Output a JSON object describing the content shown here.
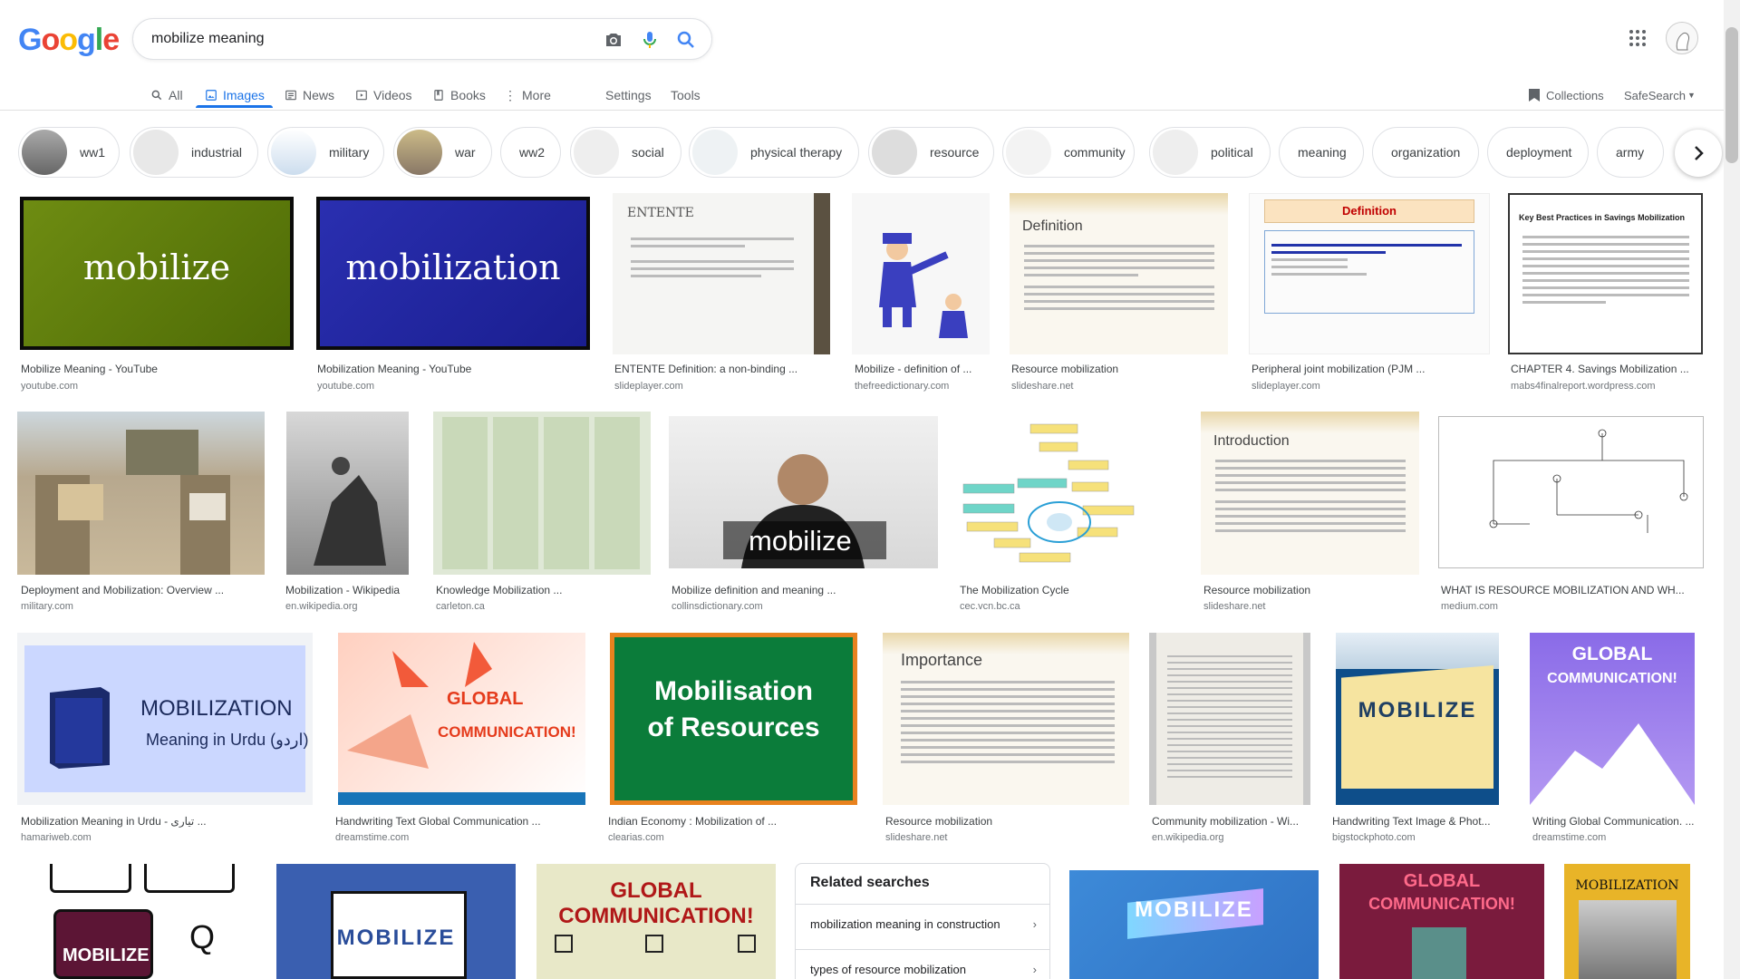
{
  "logo": {
    "letters": [
      "G",
      "o",
      "o",
      "g",
      "l",
      "e"
    ]
  },
  "search": {
    "query": "mobilize meaning"
  },
  "nav": {
    "all": "All",
    "images": "Images",
    "news": "News",
    "videos": "Videos",
    "books": "Books",
    "more": "More",
    "settings": "Settings",
    "tools": "Tools",
    "collections": "Collections",
    "safesearch": "SafeSearch"
  },
  "chips": [
    "ww1",
    "industrial",
    "military",
    "war",
    "ww2",
    "social",
    "physical therapy",
    "resource",
    "community",
    "political",
    "meaning",
    "organization",
    "deployment",
    "army"
  ],
  "results": [
    {
      "caption": "Mobilize Meaning - YouTube",
      "source": "youtube.com",
      "text": "mobilize"
    },
    {
      "caption": "Mobilization Meaning - YouTube",
      "source": "youtube.com",
      "text": "mobilization"
    },
    {
      "caption": "ENTENTE Definition: a non-binding ...",
      "source": "slideplayer.com",
      "text": "ENTENTE"
    },
    {
      "caption": "Mobilize - definition of ...",
      "source": "thefreedictionary.com",
      "text": ""
    },
    {
      "caption": "Resource mobilization",
      "source": "slideshare.net",
      "text": "Definition"
    },
    {
      "caption": "Peripheral joint mobilization (PJM ...",
      "source": "slideplayer.com",
      "text": "Definition"
    },
    {
      "caption": "CHAPTER 4. Savings Mobilization ...",
      "source": "mabs4finalreport.wordpress.com",
      "text": "Key Best Practices in Savings Mobilization"
    },
    {
      "caption": "Deployment and Mobilization: Overview ...",
      "source": "military.com",
      "text": ""
    },
    {
      "caption": "Mobilization - Wikipedia",
      "source": "en.wikipedia.org",
      "text": ""
    },
    {
      "caption": "Knowledge Mobilization ...",
      "source": "carleton.ca",
      "text": ""
    },
    {
      "caption": "Mobilize definition and meaning ...",
      "source": "collinsdictionary.com",
      "text": "mobilize"
    },
    {
      "caption": "The Mobilization Cycle",
      "source": "cec.vcn.bc.ca",
      "text": ""
    },
    {
      "caption": "Resource mobilization",
      "source": "slideshare.net",
      "text": "Introduction"
    },
    {
      "caption": "WHAT IS RESOURCE MOBILIZATION AND WH...",
      "source": "medium.com",
      "text": ""
    },
    {
      "caption": "Mobilization Meaning in Urdu - تیاری ...",
      "source": "hamariweb.com",
      "text": "MOBILIZATION",
      "text2": "Meaning in Urdu (اردو)"
    },
    {
      "caption": "Handwriting Text Global Communication ...",
      "source": "dreamstime.com",
      "text": "GLOBAL",
      "text2": "COMMUNICATION!"
    },
    {
      "caption": "Indian Economy : Mobilization of ...",
      "source": "clearias.com",
      "text": "Mobilisation",
      "text2": "of Resources"
    },
    {
      "caption": "Resource mobilization",
      "source": "slideshare.net",
      "text": "Importance"
    },
    {
      "caption": "Community mobilization - Wi...",
      "source": "en.wikipedia.org",
      "text": ""
    },
    {
      "caption": "Handwriting Text Image & Phot...",
      "source": "bigstockphoto.com",
      "text": "MOBILIZE"
    },
    {
      "caption": "Writing Global Communication. ...",
      "source": "dreamstime.com",
      "text": "GLOBAL",
      "text2": "COMMUNICATION!"
    },
    {
      "caption": "",
      "source": "",
      "text": "MOBILIZE"
    },
    {
      "caption": "",
      "source": "",
      "text": "MOBILIZE"
    },
    {
      "caption": "",
      "source": "",
      "text": "GLOBAL",
      "text2": "COMMUNICATION!"
    },
    {
      "caption": "",
      "source": "",
      "text": "MOBILIZE"
    },
    {
      "caption": "",
      "source": "",
      "text": "GLOBAL",
      "text2": "COMMUNICATION!"
    },
    {
      "caption": "",
      "source": "",
      "text": "MOBILIZATION"
    }
  ],
  "related": {
    "title": "Related searches",
    "items": [
      "mobilization meaning in construction",
      "types of resource mobilization"
    ]
  },
  "colors": {
    "accent": "#1a73e8",
    "text": "#202124",
    "muted": "#70757a"
  }
}
